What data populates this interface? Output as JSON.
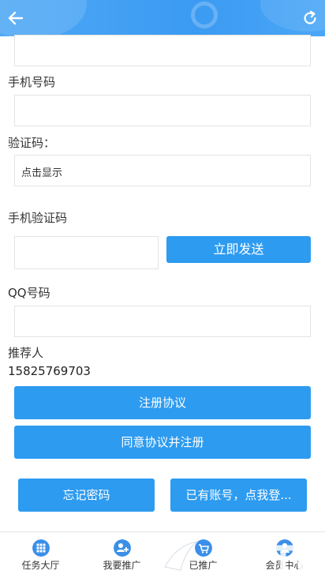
{
  "header": {
    "back_icon": "back-arrow-icon",
    "refresh_icon": "refresh-icon"
  },
  "form": {
    "phone_label": "手机号码",
    "captcha_label": "验证码：",
    "captcha_display": "点击显示",
    "sms_code_label": "手机验证码",
    "send_button": "立即发送",
    "qq_label": "QQ号码",
    "referrer_label": "推荐人",
    "referrer_value": "15825769703"
  },
  "buttons": {
    "agreement": "注册协议",
    "agree_register": "同意协议并注册",
    "forgot_password": "忘记密码",
    "have_account": "已有账号，点我登..."
  },
  "bottom_nav": [
    {
      "label": "任务大厅",
      "icon": "grid-icon"
    },
    {
      "label": "我要推广",
      "icon": "add-user-icon"
    },
    {
      "label": "已推广",
      "icon": "cart-icon"
    },
    {
      "label": "会员中心",
      "icon": "user-icon"
    }
  ],
  "colors": {
    "accent": "#2d9bf0",
    "header": "#3b9bf2"
  }
}
